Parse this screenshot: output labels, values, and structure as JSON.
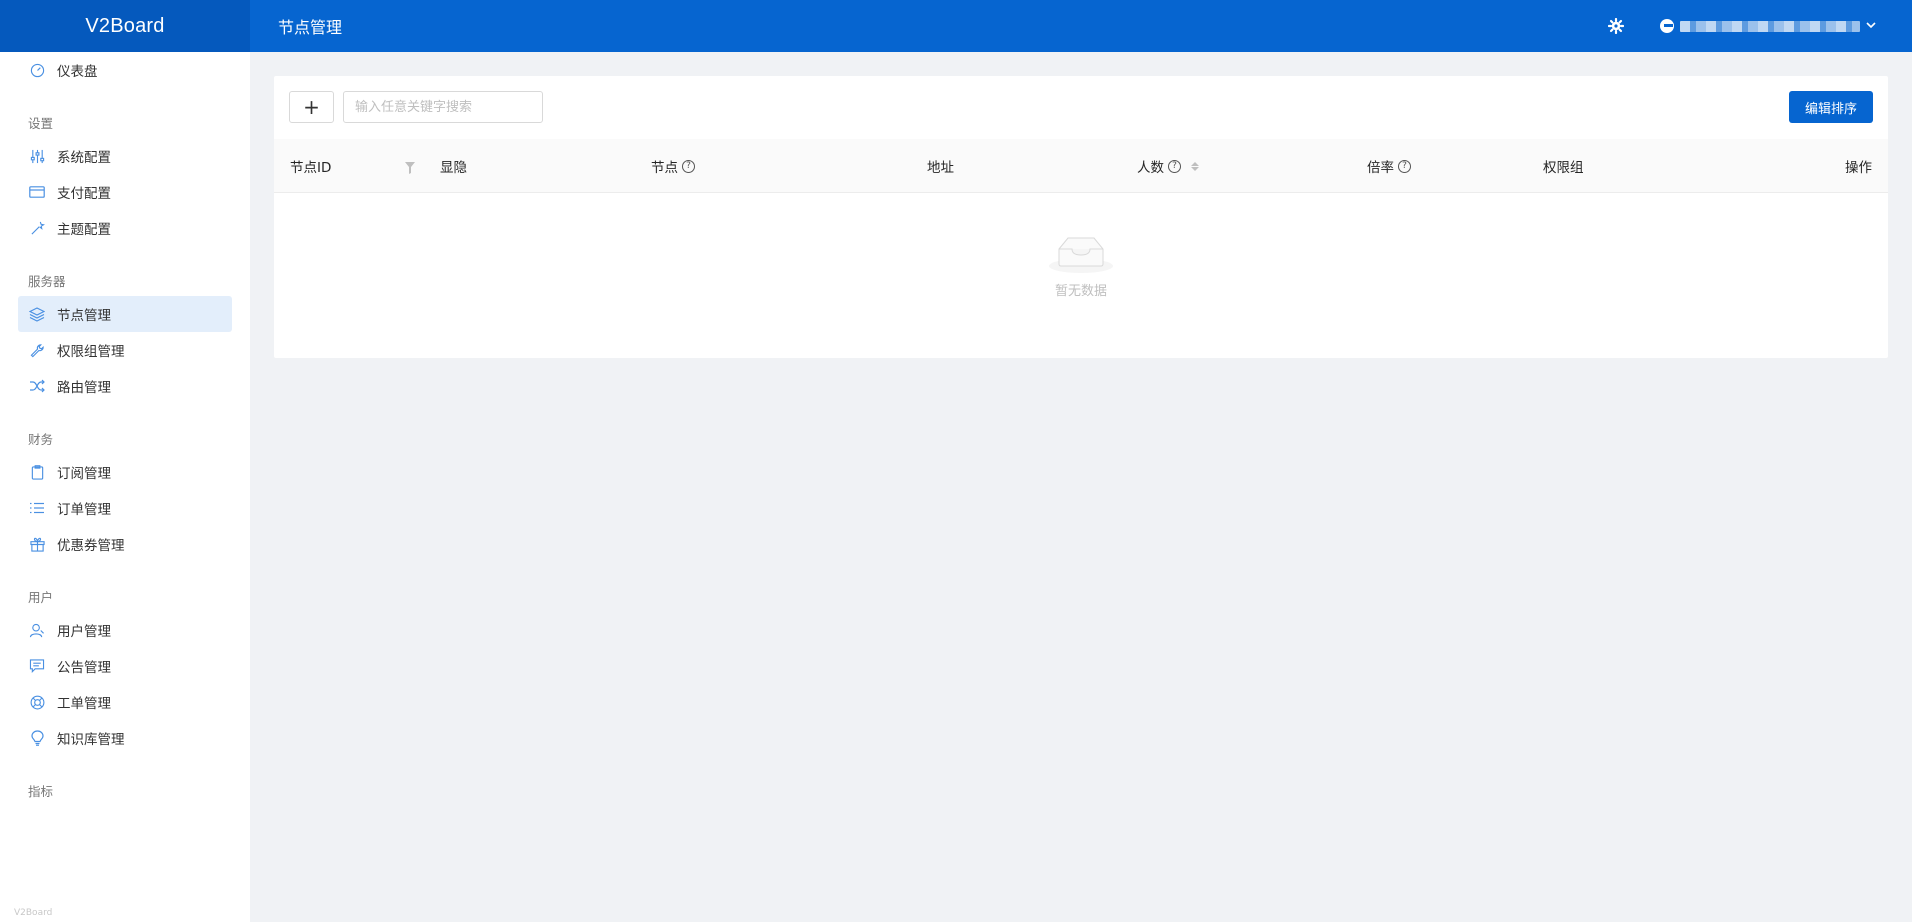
{
  "header": {
    "brand": "V2Board",
    "page_title": "节点管理",
    "user_email": "e",
    "icons": {
      "settings": "gear-icon",
      "user_dropdown": "chevron-down-icon"
    },
    "accent_color": "#0665d0"
  },
  "sidebar": {
    "dashboard": {
      "label": "仪表盘",
      "icon": "speedometer-icon"
    },
    "groups": [
      {
        "title": "设置",
        "items": [
          {
            "label": "系统配置",
            "icon": "sliders-icon"
          },
          {
            "label": "支付配置",
            "icon": "credit-card-icon"
          },
          {
            "label": "主题配置",
            "icon": "magic-wand-icon"
          }
        ]
      },
      {
        "title": "服务器",
        "items": [
          {
            "label": "节点管理",
            "icon": "layers-icon",
            "active": true
          },
          {
            "label": "权限组管理",
            "icon": "wrench-icon"
          },
          {
            "label": "路由管理",
            "icon": "shuffle-icon"
          }
        ]
      },
      {
        "title": "财务",
        "items": [
          {
            "label": "订阅管理",
            "icon": "clipboard-icon"
          },
          {
            "label": "订单管理",
            "icon": "list-icon"
          },
          {
            "label": "优惠券管理",
            "icon": "gift-icon"
          }
        ]
      },
      {
        "title": "用户",
        "items": [
          {
            "label": "用户管理",
            "icon": "user-icon"
          },
          {
            "label": "公告管理",
            "icon": "chat-icon"
          },
          {
            "label": "工单管理",
            "icon": "lifebuoy-icon"
          },
          {
            "label": "知识库管理",
            "icon": "bulb-icon"
          }
        ]
      },
      {
        "title": "指标",
        "items": []
      }
    ],
    "footer_tag": "V2Board"
  },
  "toolbar": {
    "add_label": "+",
    "search_placeholder": "输入任意关键字搜索",
    "search_value": "",
    "sort_button_label": "编辑排序"
  },
  "table": {
    "columns": [
      {
        "label": "节点ID",
        "filter": true
      },
      {
        "label": "显隐"
      },
      {
        "label": "节点",
        "help": true
      },
      {
        "label": "地址"
      },
      {
        "label": "人数",
        "help": true,
        "sortable": true
      },
      {
        "label": "倍率",
        "help": true
      },
      {
        "label": "权限组"
      },
      {
        "label": "操作"
      }
    ],
    "rows": [],
    "empty_text": "暂无数据"
  }
}
